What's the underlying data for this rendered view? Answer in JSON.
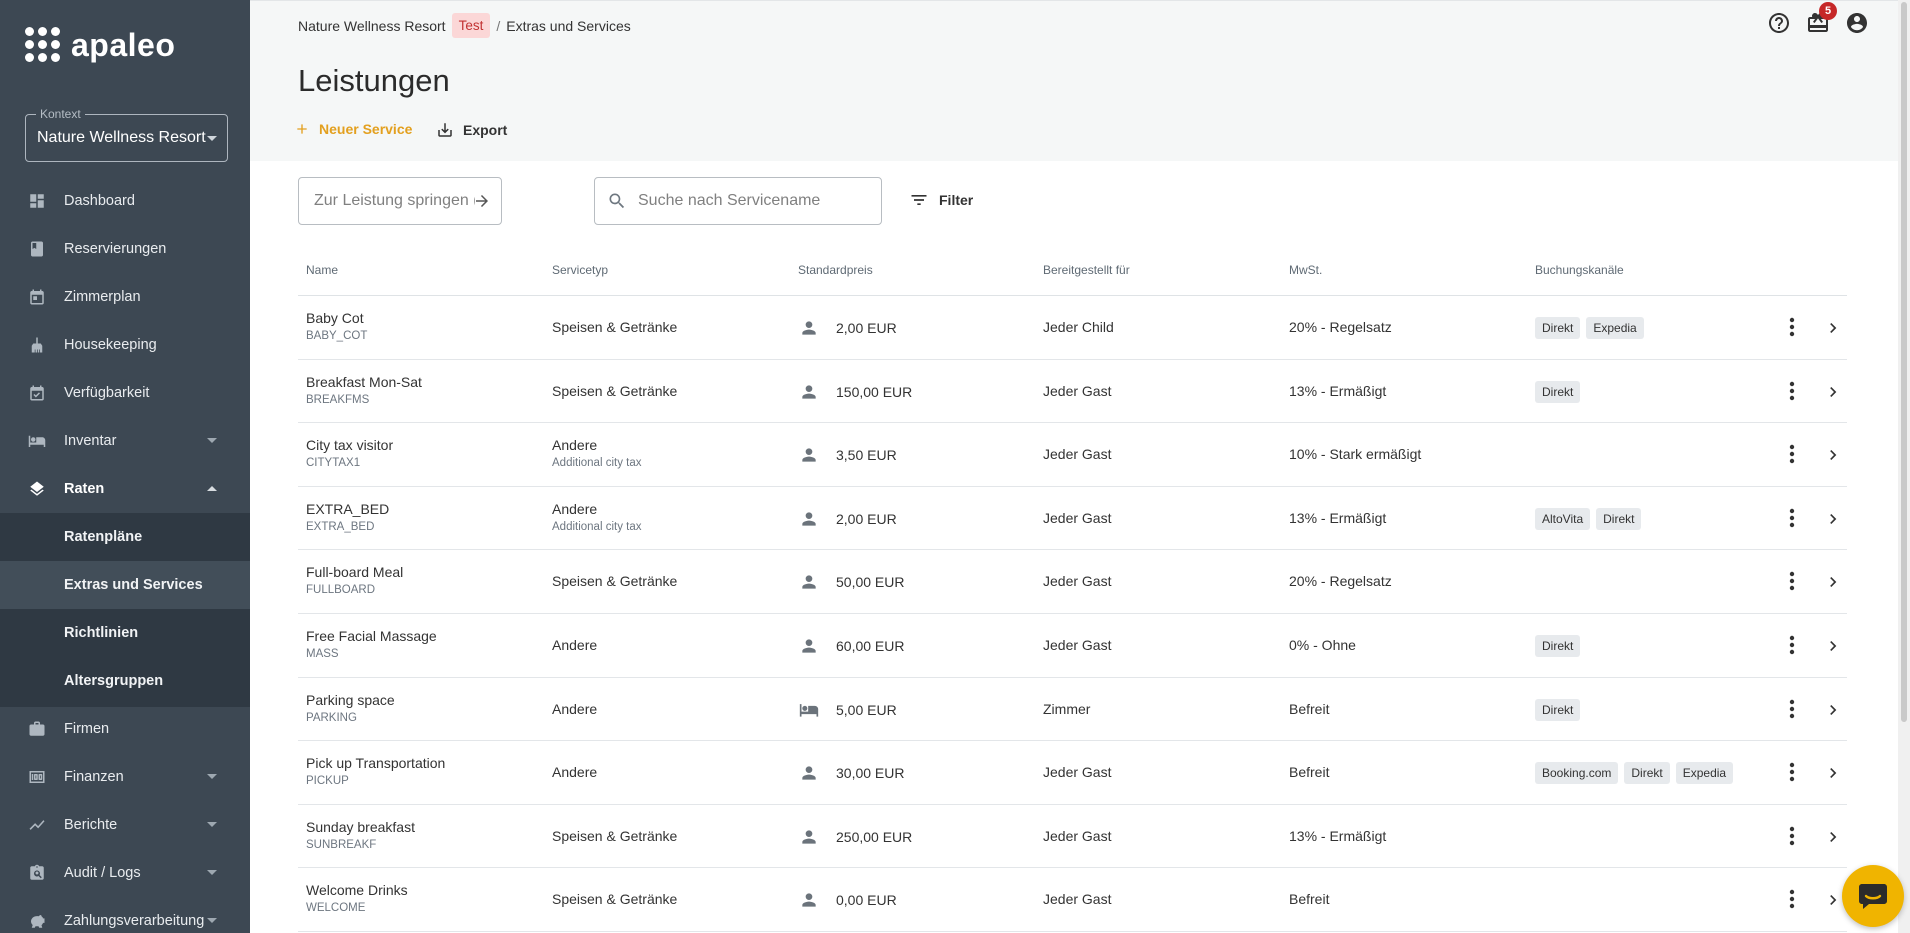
{
  "sidebar": {
    "logo_text": "apaleo",
    "context_label": "Kontext",
    "context_value": "Nature Wellness Resort",
    "nav": [
      {
        "label": "Dashboard",
        "icon": "dashboard-icon"
      },
      {
        "label": "Reservierungen",
        "icon": "book-icon"
      },
      {
        "label": "Zimmerplan",
        "icon": "calendar-icon"
      },
      {
        "label": "Housekeeping",
        "icon": "broom-icon"
      },
      {
        "label": "Verfügbarkeit",
        "icon": "calendar-check-icon"
      },
      {
        "label": "Inventar",
        "icon": "bed-icon"
      },
      {
        "label": "Raten",
        "icon": "layers-icon"
      },
      {
        "label": "Firmen",
        "icon": "briefcase-icon"
      },
      {
        "label": "Finanzen",
        "icon": "money-icon"
      },
      {
        "label": "Berichte",
        "icon": "chart-icon"
      },
      {
        "label": "Audit / Logs",
        "icon": "clipboard-search-icon"
      },
      {
        "label": "Zahlungsverarbeitung",
        "icon": "piggy-bank-icon"
      }
    ],
    "sub_items": [
      "Ratenpläne",
      "Extras und Services",
      "Richtlinien",
      "Altersgruppen"
    ]
  },
  "header": {
    "breadcrumb_property": "Nature Wellness Resort",
    "breadcrumb_badge": "Test",
    "breadcrumb_separator": "/",
    "breadcrumb_page": "Extras und Services",
    "title": "Leistungen",
    "new_service_label": "Neuer Service",
    "export_label": "Export",
    "notification_count": "5"
  },
  "toolbar": {
    "jump_placeholder": "Zur Leistung springen (nach Code)",
    "search_placeholder": "Suche nach Servicename",
    "filter_label": "Filter"
  },
  "colors": {
    "sidebar": "#3d4853",
    "accent": "#e3a01f",
    "badge": "#c62828",
    "chat": "#f0b400"
  },
  "table": {
    "headers": {
      "name": "Name",
      "type": "Servicetyp",
      "price": "Standardpreis",
      "provided_for": "Bereitgestellt für",
      "vat": "MwSt.",
      "channels": "Buchungskanäle"
    },
    "rows": [
      {
        "name": "Baby Cot",
        "code": "BABY_COT",
        "type": "Speisen & Getränke",
        "type_sub": "",
        "price_icon": "person-icon",
        "price": "2,00 EUR",
        "for": "Jeder Child",
        "vat": "20% - Regelsatz",
        "channels": [
          "Direkt",
          "Expedia"
        ]
      },
      {
        "name": "Breakfast Mon-Sat",
        "code": "BREAKFMS",
        "type": "Speisen & Getränke",
        "type_sub": "",
        "price_icon": "person-icon",
        "price": "150,00 EUR",
        "for": "Jeder Gast",
        "vat": "13% - Ermäßigt",
        "channels": [
          "Direkt"
        ]
      },
      {
        "name": "City tax visitor",
        "code": "CITYTAX1",
        "type": "Andere",
        "type_sub": "Additional city tax",
        "price_icon": "person-icon",
        "price": "3,50 EUR",
        "for": "Jeder Gast",
        "vat": "10% - Stark ermäßigt",
        "channels": []
      },
      {
        "name": "EXTRA_BED",
        "code": "EXTRA_BED",
        "type": "Andere",
        "type_sub": "Additional city tax",
        "price_icon": "person-icon",
        "price": "2,00 EUR",
        "for": "Jeder Gast",
        "vat": "13% - Ermäßigt",
        "channels": [
          "AltoVita",
          "Direkt"
        ]
      },
      {
        "name": "Full-board Meal",
        "code": "FULLBOARD",
        "type": "Speisen & Getränke",
        "type_sub": "",
        "price_icon": "person-icon",
        "price": "50,00 EUR",
        "for": "Jeder Gast",
        "vat": "20% - Regelsatz",
        "channels": []
      },
      {
        "name": "Free Facial Massage",
        "code": "MASS",
        "type": "Andere",
        "type_sub": "",
        "price_icon": "person-icon",
        "price": "60,00 EUR",
        "for": "Jeder Gast",
        "vat": "0% - Ohne",
        "channels": [
          "Direkt"
        ]
      },
      {
        "name": "Parking space",
        "code": "PARKING",
        "type": "Andere",
        "type_sub": "",
        "price_icon": "bed-icon",
        "price": "5,00 EUR",
        "for": "Zimmer",
        "vat": "Befreit",
        "channels": [
          "Direkt"
        ]
      },
      {
        "name": "Pick up Transportation",
        "code": "PICKUP",
        "type": "Andere",
        "type_sub": "",
        "price_icon": "person-icon",
        "price": "30,00 EUR",
        "for": "Jeder Gast",
        "vat": "Befreit",
        "channels": [
          "Booking.com",
          "Direkt",
          "Expedia"
        ]
      },
      {
        "name": "Sunday breakfast",
        "code": "SUNBREAKF",
        "type": "Speisen & Getränke",
        "type_sub": "",
        "price_icon": "person-icon",
        "price": "250,00 EUR",
        "for": "Jeder Gast",
        "vat": "13% - Ermäßigt",
        "channels": []
      },
      {
        "name": "Welcome Drinks",
        "code": "WELCOME",
        "type": "Speisen & Getränke",
        "type_sub": "",
        "price_icon": "person-icon",
        "price": "0,00 EUR",
        "for": "Jeder Gast",
        "vat": "Befreit",
        "channels": []
      }
    ]
  }
}
